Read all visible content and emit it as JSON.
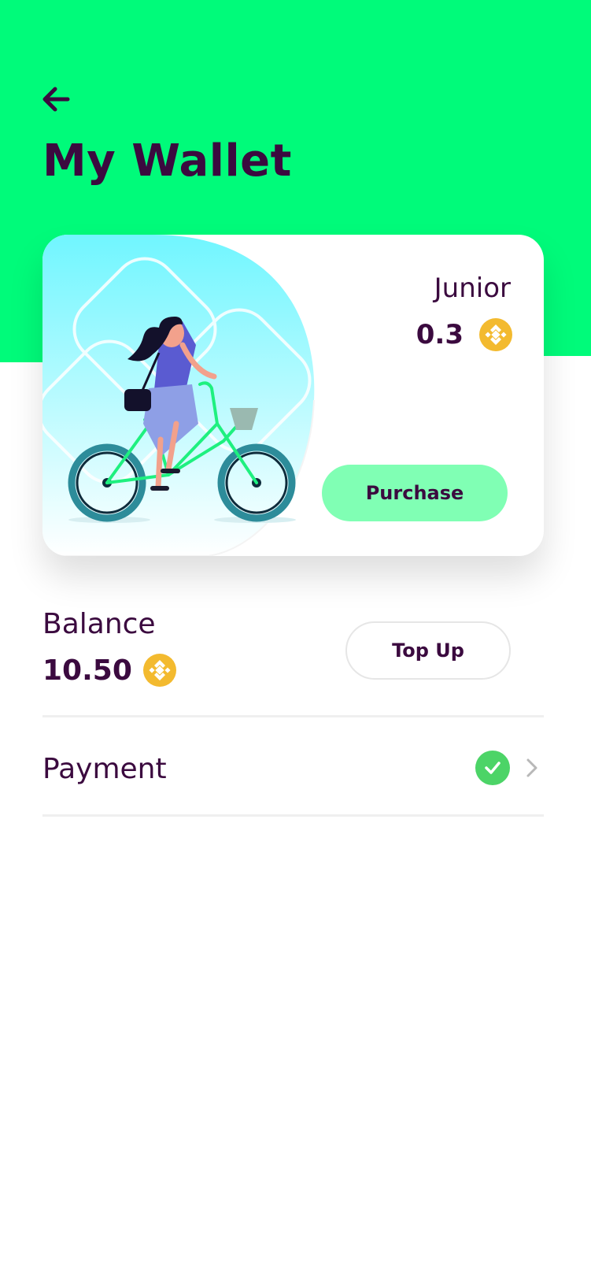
{
  "colors": {
    "header_green": "#00fb7a",
    "brand_purple": "#3b0a3f",
    "purchase_green": "#80ffb4",
    "coin_gold": "#f3ba2f",
    "check_green": "#4cd467"
  },
  "header": {
    "back_icon": "arrow-left-icon",
    "title": "My Wallet"
  },
  "wallet_card": {
    "illustration": "woman-riding-bicycle",
    "tier_name": "Junior",
    "tier_value": "0.3",
    "coin_icon": "bnb-coin-icon",
    "purchase_label": "Purchase"
  },
  "balance": {
    "label": "Balance",
    "value": "10.50",
    "coin_icon": "bnb-coin-icon",
    "topup_label": "Top Up"
  },
  "payment": {
    "label": "Payment",
    "status_icon": "check-circle-icon",
    "chevron_icon": "chevron-right-icon"
  }
}
